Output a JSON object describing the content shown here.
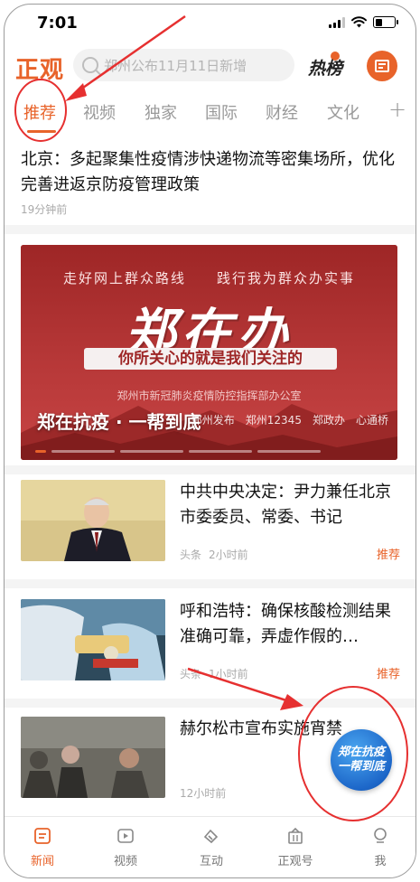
{
  "status_bar": {
    "time": "7:01"
  },
  "header": {
    "logo": "正观",
    "search_placeholder": "郑州公布11月11日新增",
    "hot_rank_label": "热榜"
  },
  "tabs": [
    {
      "label": "推荐",
      "active": true
    },
    {
      "label": "视频"
    },
    {
      "label": "独家"
    },
    {
      "label": "国际"
    },
    {
      "label": "财经"
    },
    {
      "label": "文化"
    }
  ],
  "tab_add": "+",
  "top_story": {
    "title": "北京：多起聚集性疫情涉快递物流等密集场所，优化完善进返京防疫管理政策",
    "time": "19分钟前"
  },
  "banner": {
    "top_line": "走好网上群众路线　　践行我为群众办实事",
    "title": "郑在办",
    "ribbon": "你所关心的就是我们关注的",
    "org": "郑州市新冠肺炎疫情防控指挥部办公室",
    "caption": "郑在抗疫 · 一帮到底",
    "logos": [
      "郑州发布",
      "郑州12345",
      "郑政办",
      "心通桥"
    ]
  },
  "news": [
    {
      "title": "中共中央决定：尹力兼任北京市委委员、常委、书记",
      "source": "头条",
      "time": "2小时前",
      "tag": "推荐"
    },
    {
      "title": "呼和浩特：确保核酸检测结果准确可靠，弄虚作假的…",
      "source": "头条",
      "time": "1小时前",
      "tag": "推荐"
    },
    {
      "title": "赫尔松市宣布实施宵禁",
      "source": "",
      "time": "12小时前",
      "tag": ""
    }
  ],
  "float_badge": {
    "line1": "郑在抗疫",
    "line2": "一帮到底"
  },
  "tab_bar": [
    {
      "label": "新闻",
      "icon": "news-icon",
      "active": true
    },
    {
      "label": "视频",
      "icon": "video-icon"
    },
    {
      "label": "互动",
      "icon": "interact-icon"
    },
    {
      "label": "正观号",
      "icon": "account-icon"
    },
    {
      "label": "我",
      "icon": "me-icon"
    }
  ],
  "colors": {
    "accent": "#e8632a",
    "annotation": "#e63030",
    "banner_red": "#a52c2c",
    "badge_blue": "#1d67c9"
  }
}
